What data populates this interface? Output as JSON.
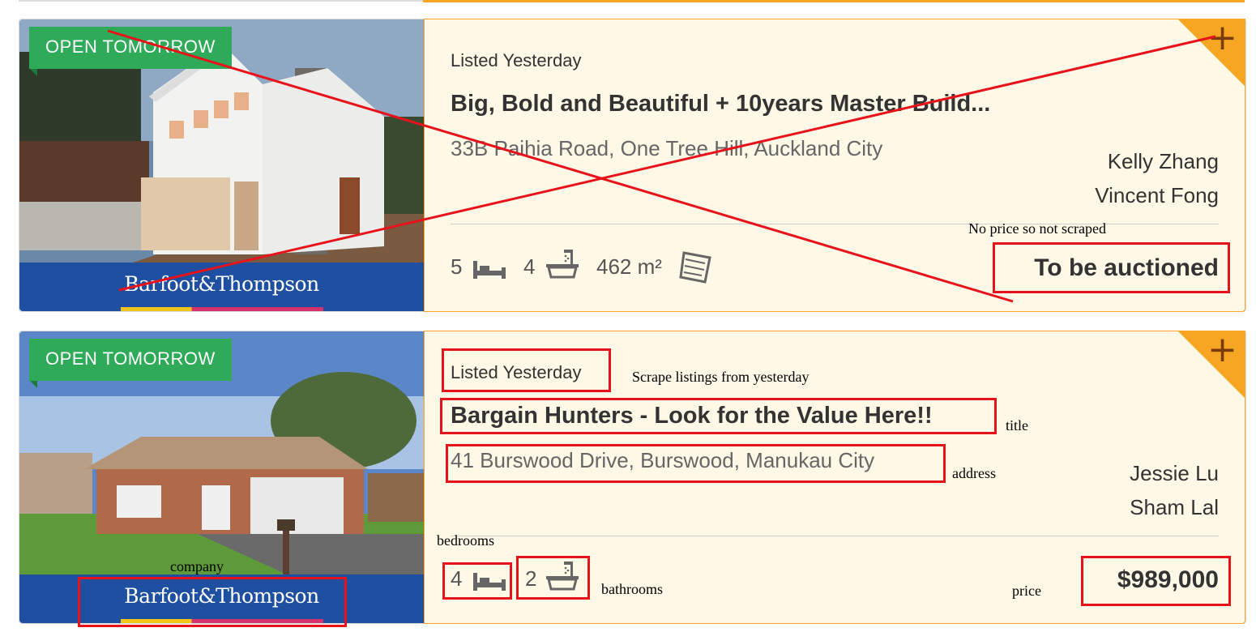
{
  "listings": [
    {
      "badge": "OPEN  TOMORROW",
      "company": "Barfoot&Thompson",
      "listed": "Listed Yesterday",
      "title": "Big, Bold and Beautiful + 10years Master Build...",
      "address": "33B Paihia Road, One Tree Hill, Auckland City",
      "agents": [
        "Kelly Zhang",
        "Vincent Fong"
      ],
      "bedrooms": "5",
      "bathrooms": "4",
      "area": "462 m²",
      "price": "To be auctioned",
      "add_icon": "plus-icon"
    },
    {
      "badge": "OPEN  TOMORROW",
      "company": "Barfoot&Thompson",
      "listed": "Listed Yesterday",
      "title": "Bargain Hunters - Look for the Value Here!!",
      "address": "41 Burswood Drive, Burswood, Manukau City",
      "agents": [
        "Jessie Lu",
        "Sham Lal"
      ],
      "bedrooms": "4",
      "bathrooms": "2",
      "price": "$989,000",
      "add_icon": "plus-icon"
    }
  ],
  "annotations": {
    "no_price_note": "No price so not scraped",
    "listed_note": "Scrape listings from yesterday",
    "title_note": "title",
    "address_note": "address",
    "bedrooms_note": "bedrooms",
    "company_note": "company",
    "bathrooms_note": "bathrooms",
    "price_note": "price",
    "color": "#e8121b"
  },
  "colors": {
    "accent": "#f6a623",
    "panel_bg": "#fef8e6",
    "badge_green": "#2eaa58",
    "logo_blue": "#1f4fa0"
  }
}
